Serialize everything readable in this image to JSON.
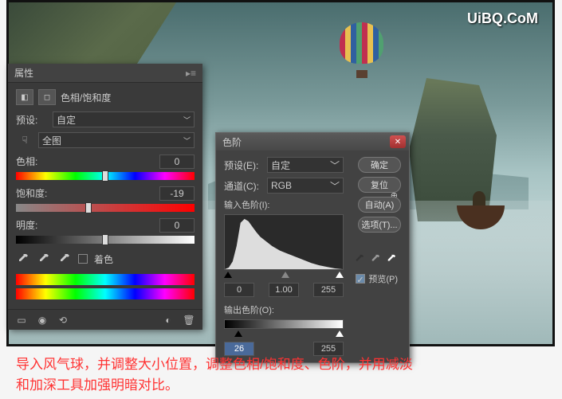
{
  "watermark": "UiBQ.CoM",
  "hue_panel": {
    "title": "属性",
    "adj_label": "色相/饱和度",
    "preset_label": "预设:",
    "preset_value": "自定",
    "scope_value": "全图",
    "hue_label": "色相:",
    "hue_value": "0",
    "sat_label": "饱和度:",
    "sat_value": "-19",
    "light_label": "明度:",
    "light_value": "0",
    "colorize_label": "着色"
  },
  "levels_panel": {
    "title": "色阶",
    "preset_label": "预设(E):",
    "preset_value": "自定",
    "channel_label": "通道(C):",
    "channel_value": "RGB",
    "input_label": "输入色阶(I):",
    "output_label": "输出色阶(O):",
    "in_black": "0",
    "in_mid": "1.00",
    "in_white": "255",
    "out_black": "26",
    "out_white": "255",
    "btn_ok": "确定",
    "btn_cancel": "复位",
    "btn_auto": "自动(A)",
    "btn_options": "选项(T)...",
    "preview_label": "预览(P)"
  },
  "caption_line1": "导入风气球，并调整大小位置，调整色相/饱和度、色阶，并用减淡",
  "caption_line2": "和加深工具加强明暗对比。"
}
